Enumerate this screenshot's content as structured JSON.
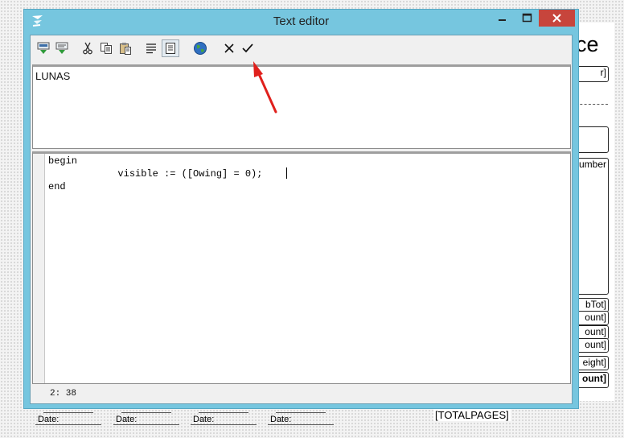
{
  "window": {
    "title": "Text editor",
    "title_bar_color": "#76c6df",
    "close_button_color": "#c7453c"
  },
  "toolbar": {
    "buttons": [
      {
        "icon": "insert-field-icon"
      },
      {
        "icon": "insert-variable-icon"
      },
      {
        "icon": "cut-icon"
      },
      {
        "icon": "copy-icon"
      },
      {
        "icon": "paste-icon"
      },
      {
        "icon": "word-wrap-icon"
      },
      {
        "icon": "script-mode-icon",
        "pressed": true
      },
      {
        "icon": "globe-icon"
      },
      {
        "icon": "cancel-icon"
      },
      {
        "icon": "ok-checkmark-icon"
      }
    ]
  },
  "text_pane": {
    "value": "LUNAS"
  },
  "code_pane": {
    "lines": [
      "begin",
      "            visible := ([Owing] = 0);",
      "end"
    ]
  },
  "status": {
    "cursor_position": "2: 38"
  },
  "background_report": {
    "title_fragment": "ce",
    "fields": [
      "r]",
      "umber",
      "bTot]",
      "ount]",
      "ount]",
      "ount]",
      "eight]",
      "ount]"
    ],
    "date_labels": [
      "Date:",
      "Date:",
      "Date:",
      "Date:"
    ],
    "total_pages": "[TOTALPAGES]"
  },
  "annotation": {
    "arrow_color": "#e0201c"
  }
}
